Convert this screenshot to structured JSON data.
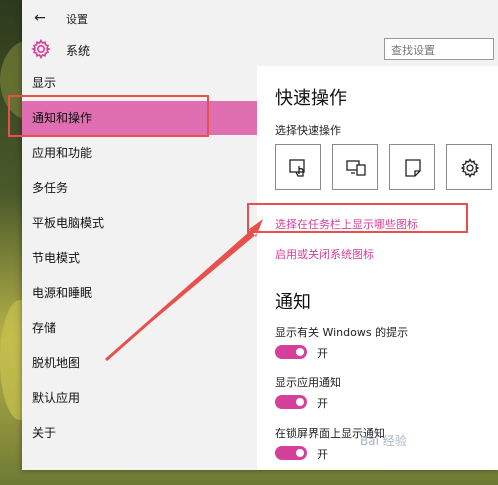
{
  "window": {
    "title": "设置",
    "header": {
      "title": "系统",
      "search_placeholder": "查找设置"
    }
  },
  "sidebar": {
    "items": [
      {
        "label": "显示"
      },
      {
        "label": "通知和操作",
        "selected": true
      },
      {
        "label": "应用和功能"
      },
      {
        "label": "多任务"
      },
      {
        "label": "平板电脑模式"
      },
      {
        "label": "节电模式"
      },
      {
        "label": "电源和睡眠"
      },
      {
        "label": "存储"
      },
      {
        "label": "脱机地图"
      },
      {
        "label": "默认应用"
      },
      {
        "label": "关于"
      }
    ]
  },
  "main": {
    "quick_actions": {
      "title": "快速操作",
      "subtitle": "选择快速操作",
      "tiles": [
        {
          "icon": "tablet-mode-icon"
        },
        {
          "icon": "project-display-icon"
        },
        {
          "icon": "note-icon"
        },
        {
          "icon": "settings-gear-icon"
        }
      ]
    },
    "links": {
      "taskbar_icons": "选择在任务栏上显示哪些图标",
      "system_icons": "启用或关闭系统图标"
    },
    "notifications": {
      "title": "通知",
      "settings": [
        {
          "label": "显示有关 Windows 的提示",
          "state": "开",
          "on": true
        },
        {
          "label": "显示应用通知",
          "state": "开",
          "on": true
        },
        {
          "label": "在锁屏界面上显示通知",
          "state": "开",
          "on": true
        }
      ]
    }
  },
  "colors": {
    "accent": "#d4409a",
    "selected_bg": "#e06fb2",
    "annotation": "#e8504e"
  }
}
